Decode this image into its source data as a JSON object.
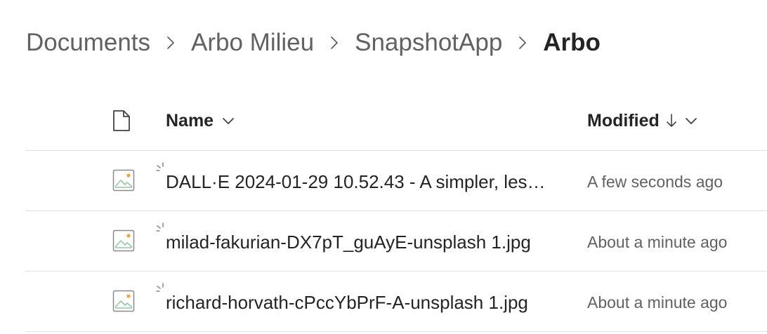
{
  "breadcrumb": {
    "items": [
      {
        "label": "Documents"
      },
      {
        "label": "Arbo Milieu"
      },
      {
        "label": "SnapshotApp"
      },
      {
        "label": "Arbo"
      }
    ],
    "separator_icon": "chevron-right-icon"
  },
  "columns": {
    "type_icon": "document-icon",
    "name_label": "Name",
    "name_menu_icon": "chevron-down-icon",
    "modified_label": "Modified",
    "modified_sort_icon": "arrow-down-icon",
    "modified_menu_icon": "chevron-down-icon"
  },
  "files": [
    {
      "icon": "image-file-icon",
      "status_icon": "loading-spinner-icon",
      "name": "DALL·E 2024-01-29 10.52.43 - A simpler, les…",
      "modified": "A few seconds ago"
    },
    {
      "icon": "image-file-icon",
      "status_icon": "loading-spinner-icon",
      "name": "milad-fakurian-DX7pT_guAyE-unsplash 1.jpg",
      "modified": "About a minute ago"
    },
    {
      "icon": "image-file-icon",
      "status_icon": "loading-spinner-icon",
      "name": "richard-horvath-cPccYbPrF-A-unsplash 1.jpg",
      "modified": "About a minute ago"
    }
  ],
  "colors": {
    "text_primary": "#242424",
    "text_secondary": "#616161",
    "divider": "#e1e1e1",
    "icon_accent": "#f7a440",
    "icon_green": "#8fc9a4"
  }
}
